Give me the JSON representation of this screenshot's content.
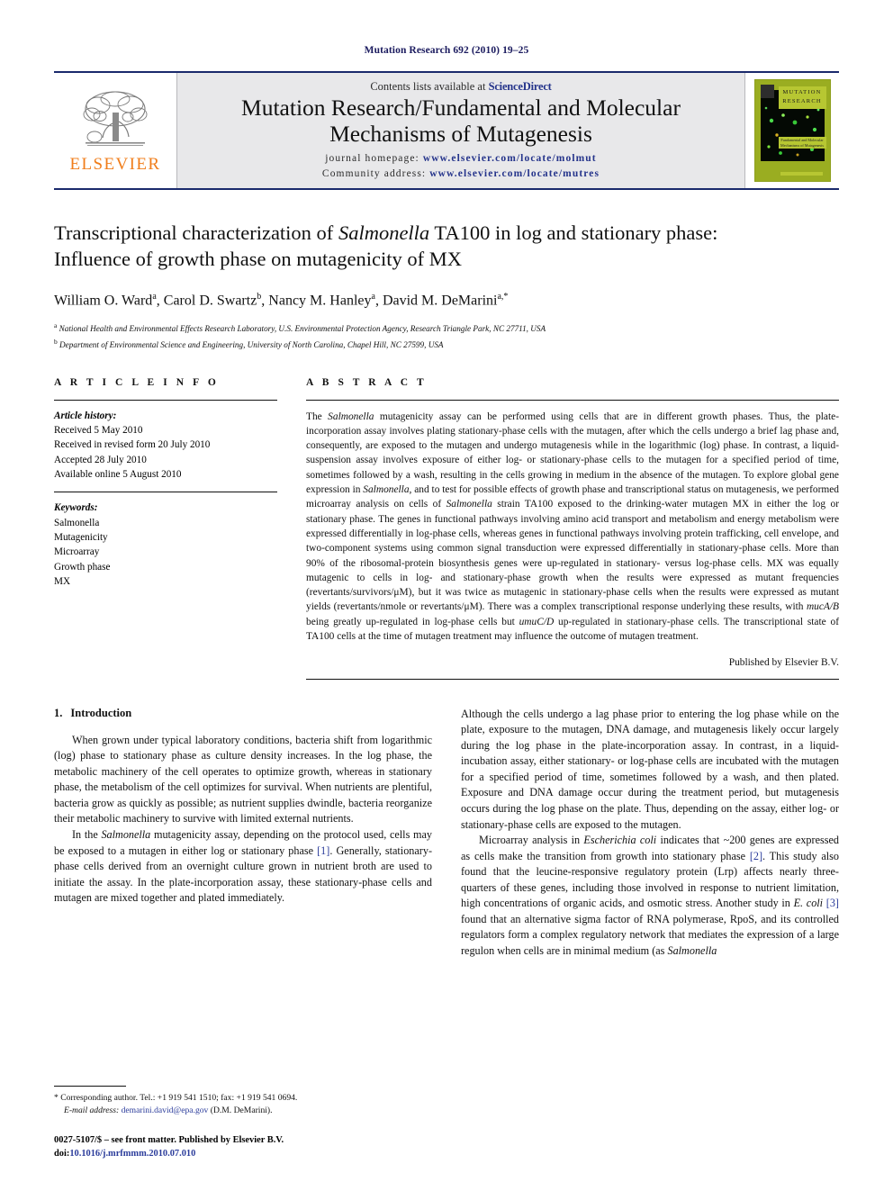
{
  "running_head": "Mutation Research 692 (2010) 19–25",
  "masthead": {
    "publisher_name": "ELSEVIER",
    "contents_prefix": "Contents lists available at ",
    "contents_brand": "ScienceDirect",
    "journal_title_line1": "Mutation Research/Fundamental and Molecular",
    "journal_title_line2": "Mechanisms of Mutagenesis",
    "homepage_label": "journal homepage:",
    "homepage_url": "www.elsevier.com/locate/molmut",
    "community_label": "Community address:",
    "community_url": "www.elsevier.com/locate/mutres",
    "cover": {
      "title_line1": "MUTATION",
      "title_line2": "RESEARCH",
      "subtitle_line1": "Fundamental and Molecular",
      "subtitle_line2": "Mechanisms of Mutagenesis"
    }
  },
  "article": {
    "title_part1": "Transcriptional characterization of ",
    "title_italic": "Salmonella",
    "title_part2": " TA100 in log and stationary phase:",
    "title_line2": "Influence of growth phase on mutagenicity of MX",
    "authors": [
      {
        "name": "William O. Ward",
        "sup": "a",
        "sep": ", "
      },
      {
        "name": "Carol D. Swartz",
        "sup": "b",
        "sep": ", "
      },
      {
        "name": "Nancy M. Hanley",
        "sup": "a",
        "sep": ", "
      },
      {
        "name": "David M. DeMarini",
        "sup": "a,*",
        "sep": ""
      }
    ],
    "affiliations": [
      {
        "sup": "a",
        "text": "National Health and Environmental Effects Research Laboratory, U.S. Environmental Protection Agency, Research Triangle Park, NC 27711, USA"
      },
      {
        "sup": "b",
        "text": "Department of Environmental Science and Engineering, University of North Carolina, Chapel Hill, NC 27599, USA"
      }
    ]
  },
  "article_info": {
    "heading": "A R T I C L E   I N F O",
    "history_label": "Article history:",
    "history": [
      "Received 5 May 2010",
      "Received in revised form 20 July 2010",
      "Accepted 28 July 2010",
      "Available online 5 August 2010"
    ],
    "keywords_label": "Keywords:",
    "keywords": [
      "Salmonella",
      "Mutagenicity",
      "Microarray",
      "Growth phase",
      "MX"
    ]
  },
  "abstract": {
    "heading": "A B S T R A C T",
    "text_segments": [
      {
        "t": "The ",
        "i": false
      },
      {
        "t": "Salmonella",
        "i": true
      },
      {
        "t": " mutagenicity assay can be performed using cells that are in different growth phases. Thus, the plate-incorporation assay involves plating stationary-phase cells with the mutagen, after which the cells undergo a brief lag phase and, consequently, are exposed to the mutagen and undergo mutagenesis while in the logarithmic (log) phase. In contrast, a liquid-suspension assay involves exposure of either log- or stationary-phase cells to the mutagen for a specified period of time, sometimes followed by a wash, resulting in the cells growing in medium in the absence of the mutagen. To explore global gene expression in ",
        "i": false
      },
      {
        "t": "Salmonella",
        "i": true
      },
      {
        "t": ", and to test for possible effects of growth phase and transcriptional status on mutagenesis, we performed microarray analysis on cells of ",
        "i": false
      },
      {
        "t": "Salmonella",
        "i": true
      },
      {
        "t": " strain TA100 exposed to the drinking-water mutagen MX in either the log or stationary phase. The genes in functional pathways involving amino acid transport and metabolism and energy metabolism were expressed differentially in log-phase cells, whereas genes in functional pathways involving protein trafficking, cell envelope, and two-component systems using common signal transduction were expressed differentially in stationary-phase cells. More than 90% of the ribosomal-protein biosynthesis genes were up-regulated in stationary- versus log-phase cells. MX was equally mutagenic to cells in log- and stationary-phase growth when the results were expressed as mutant frequencies (revertants/survivors/μM), but it was twice as mutagenic in stationary-phase cells when the results were expressed as mutant yields (revertants/nmole or revertants/μM). There was a complex transcriptional response underlying these results, with ",
        "i": false
      },
      {
        "t": "mucA/B",
        "i": true
      },
      {
        "t": " being greatly up-regulated in log-phase cells but ",
        "i": false
      },
      {
        "t": "umuC/D",
        "i": true
      },
      {
        "t": " up-regulated in stationary-phase cells. The transcriptional state of TA100 cells at the time of mutagen treatment may influence the outcome of mutagen treatment.",
        "i": false
      }
    ],
    "published_by": "Published by Elsevier B.V."
  },
  "introduction": {
    "number": "1.",
    "title": "Introduction",
    "left_paragraphs": [
      [
        {
          "t": "When grown under typical laboratory conditions, bacteria shift from logarithmic (log) phase to stationary phase as culture density increases. In the log phase, the metabolic machinery of the cell operates to optimize growth, whereas in stationary phase, the metabolism of the cell optimizes for survival. When nutrients are plentiful, bacteria grow as quickly as possible; as nutrient supplies dwindle, bacteria reorganize their metabolic machinery to survive with limited external nutrients.",
          "i": false
        }
      ],
      [
        {
          "t": "In the ",
          "i": false
        },
        {
          "t": "Salmonella",
          "i": true
        },
        {
          "t": " mutagenicity assay, depending on the protocol used, cells may be exposed to a mutagen in either log or stationary phase ",
          "i": false
        },
        {
          "t": "[1]",
          "i": false,
          "c": true
        },
        {
          "t": ". Generally, stationary-phase cells derived from an overnight culture grown in nutrient broth are used to initiate the assay. In the plate-incorporation assay, these stationary-phase cells and mutagen are mixed together and plated immediately.",
          "i": false
        }
      ]
    ],
    "right_paragraphs": [
      [
        {
          "t": "Although the cells undergo a lag phase prior to entering the log phase while on the plate, exposure to the mutagen, DNA damage, and mutagenesis likely occur largely during the log phase in the plate-incorporation assay. In contrast, in a liquid-incubation assay, either stationary- or log-phase cells are incubated with the mutagen for a specified period of time, sometimes followed by a wash, and then plated. Exposure and DNA damage occur during the treatment period, but mutagenesis occurs during the log phase on the plate. Thus, depending on the assay, either log- or stationary-phase cells are exposed to the mutagen.",
          "i": false
        }
      ],
      [
        {
          "t": "Microarray analysis in ",
          "i": false
        },
        {
          "t": "Escherichia coli",
          "i": true
        },
        {
          "t": " indicates that ~200 genes are expressed as cells make the transition from growth into stationary phase ",
          "i": false
        },
        {
          "t": "[2]",
          "i": false,
          "c": true
        },
        {
          "t": ". This study also found that the leucine-responsive regulatory protein (Lrp) affects nearly three-quarters of these genes, including those involved in response to nutrient limitation, high concentrations of organic acids, and osmotic stress. Another study in ",
          "i": false
        },
        {
          "t": "E. coli",
          "i": true
        },
        {
          "t": " ",
          "i": false
        },
        {
          "t": "[3]",
          "i": false,
          "c": true
        },
        {
          "t": " found that an alternative sigma factor of RNA polymerase, RpoS, and its controlled regulators form a complex regulatory network that mediates the expression of a large regulon when cells are in minimal medium (as ",
          "i": false
        },
        {
          "t": "Salmonella",
          "i": true
        }
      ]
    ]
  },
  "footnote": {
    "star": "*",
    "corresponding": " Corresponding author. Tel.: +1 919 541 1510; fax: +1 919 541 0694.",
    "email_label": "E-mail address:",
    "email": "demarini.david@epa.gov",
    "email_suffix": " (D.M. DeMarini).",
    "issn_line": "0027-5107/$ – see front matter. Published by Elsevier B.V.",
    "doi_label": "doi:",
    "doi_value": "10.1016/j.mrfmmm.2010.07.010"
  }
}
